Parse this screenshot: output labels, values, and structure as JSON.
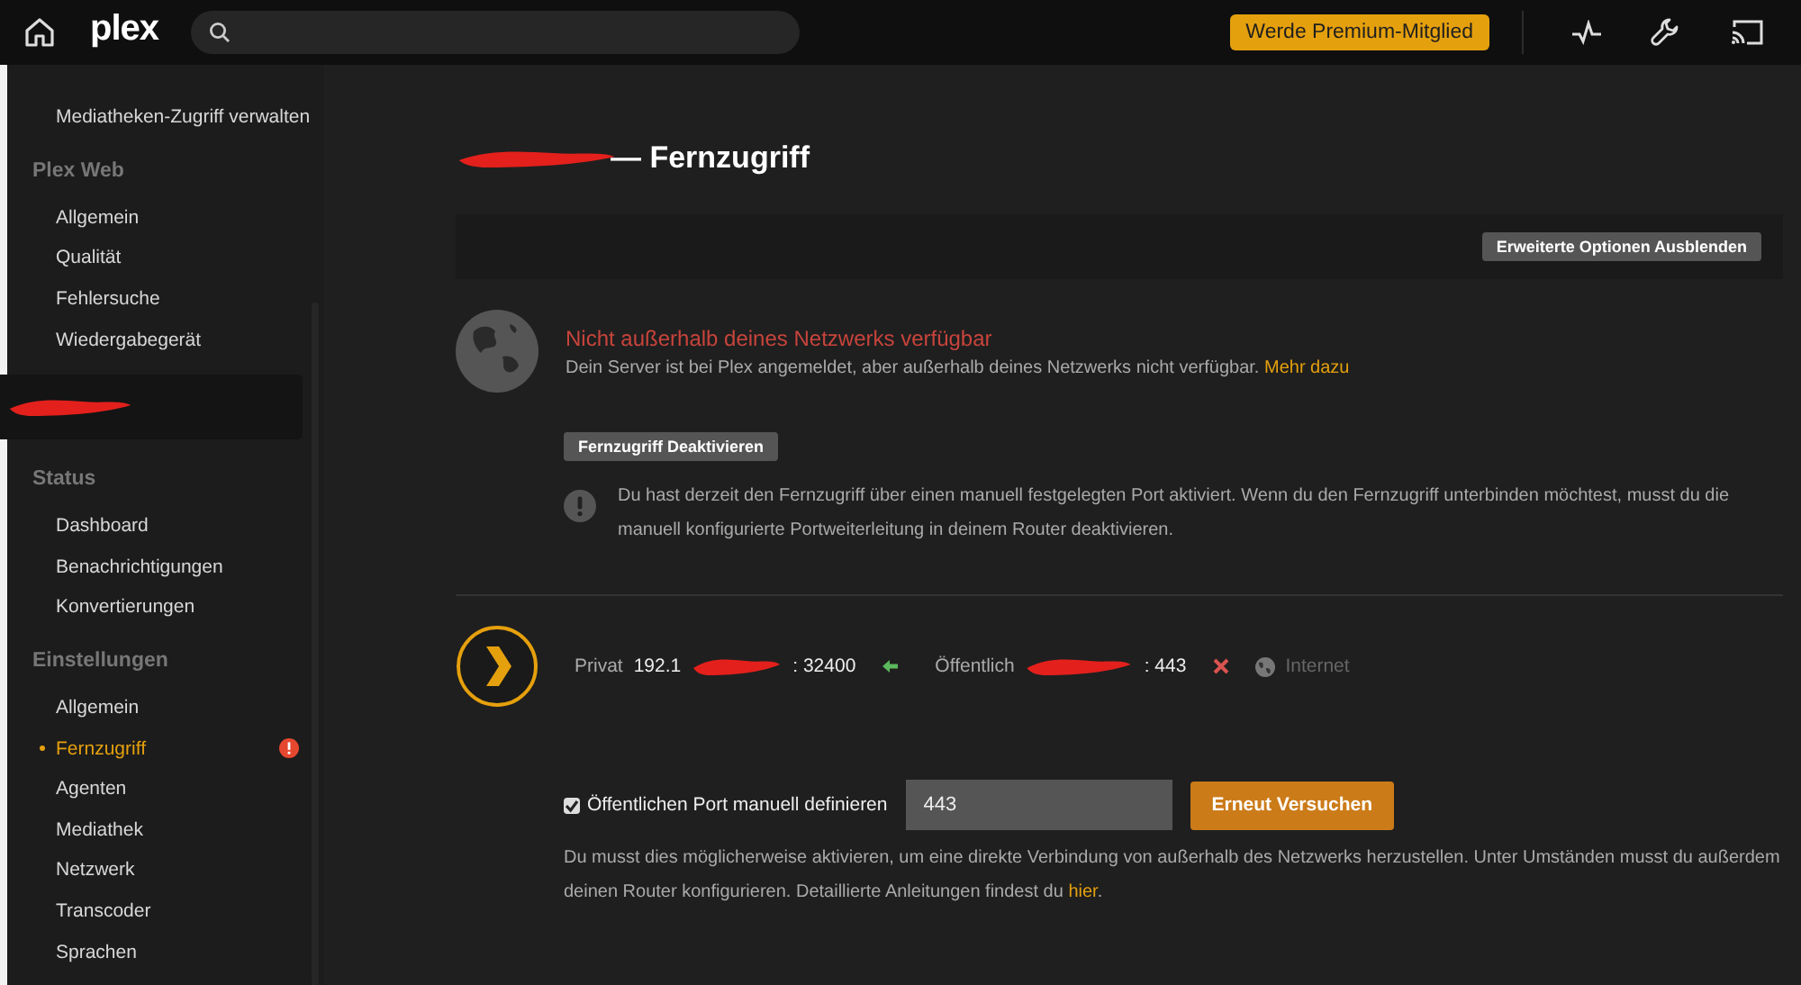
{
  "topbar": {
    "logo": "plex",
    "premium_button": "Werde Premium-Mitglied"
  },
  "sidebar": {
    "groups": [
      {
        "kind": "section",
        "items": [
          {
            "label": "Mediatheken-Zugriff verwalten",
            "selected": false,
            "alert": false
          }
        ]
      },
      {
        "kind": "section",
        "title": "Plex Web",
        "items": [
          {
            "label": "Allgemein",
            "selected": false,
            "alert": false
          },
          {
            "label": "Qualität",
            "selected": false,
            "alert": false
          },
          {
            "label": "Fehlersuche",
            "selected": false,
            "alert": false
          },
          {
            "label": "Wiedergabegerät",
            "selected": false,
            "alert": false
          }
        ]
      },
      {
        "kind": "server"
      },
      {
        "kind": "section",
        "title": "Status",
        "items": [
          {
            "label": "Dashboard",
            "selected": false,
            "alert": false
          },
          {
            "label": "Benachrichtigungen",
            "selected": false,
            "alert": false
          },
          {
            "label": "Konvertierungen",
            "selected": false,
            "alert": false
          }
        ]
      },
      {
        "kind": "section",
        "title": "Einstellungen",
        "items": [
          {
            "label": "Allgemein",
            "selected": false,
            "alert": false
          },
          {
            "label": "Fernzugriff",
            "selected": true,
            "alert": true
          },
          {
            "label": "Agenten",
            "selected": false,
            "alert": false
          },
          {
            "label": "Mediathek",
            "selected": false,
            "alert": false
          },
          {
            "label": "Netzwerk",
            "selected": false,
            "alert": false
          },
          {
            "label": "Transcoder",
            "selected": false,
            "alert": false
          },
          {
            "label": "Sprachen",
            "selected": false,
            "alert": false
          }
        ]
      }
    ]
  },
  "main": {
    "title": "— Fernzugriff",
    "advanced_button": "Erweiterte Optionen Ausblenden",
    "status": {
      "title": "Nicht außerhalb deines Netzwerks verfügbar",
      "text": "Dein Server ist bei Plex angemeldet, aber außerhalb deines Netzwerks nicht verfügbar.",
      "link": "Mehr dazu"
    },
    "deactivate_button": "Fernzugriff Deaktivieren",
    "notice": "Du hast derzeit den Fernzugriff über einen manuell festgelegten Port aktiviert. Wenn du den Fernzugriff unterbinden möchtest, musst du die manuell konfigurierte Portweiterleitung in deinem Router deaktivieren.",
    "connection": {
      "private_label": "Privat",
      "private_address": "192.1",
      "private_port": ": 32400",
      "private_reachable": true,
      "public_label": "Öffentlich",
      "public_port": ": 443",
      "public_reachable": false,
      "internet_label": "Internet"
    },
    "port": {
      "checked": true,
      "label": "Öffentlichen Port manuell definieren",
      "value": "443",
      "retry_button": "Erneut Versuchen"
    },
    "help": {
      "text": "Du musst dies möglicherweise aktivieren, um eine direkte Verbindung von außerhalb des Netzwerks herzustellen. Unter Umständen musst du außerdem deinen Router konfigurieren. Detaillierte Anleitungen findest du",
      "link": "hier",
      "tail": "."
    }
  }
}
